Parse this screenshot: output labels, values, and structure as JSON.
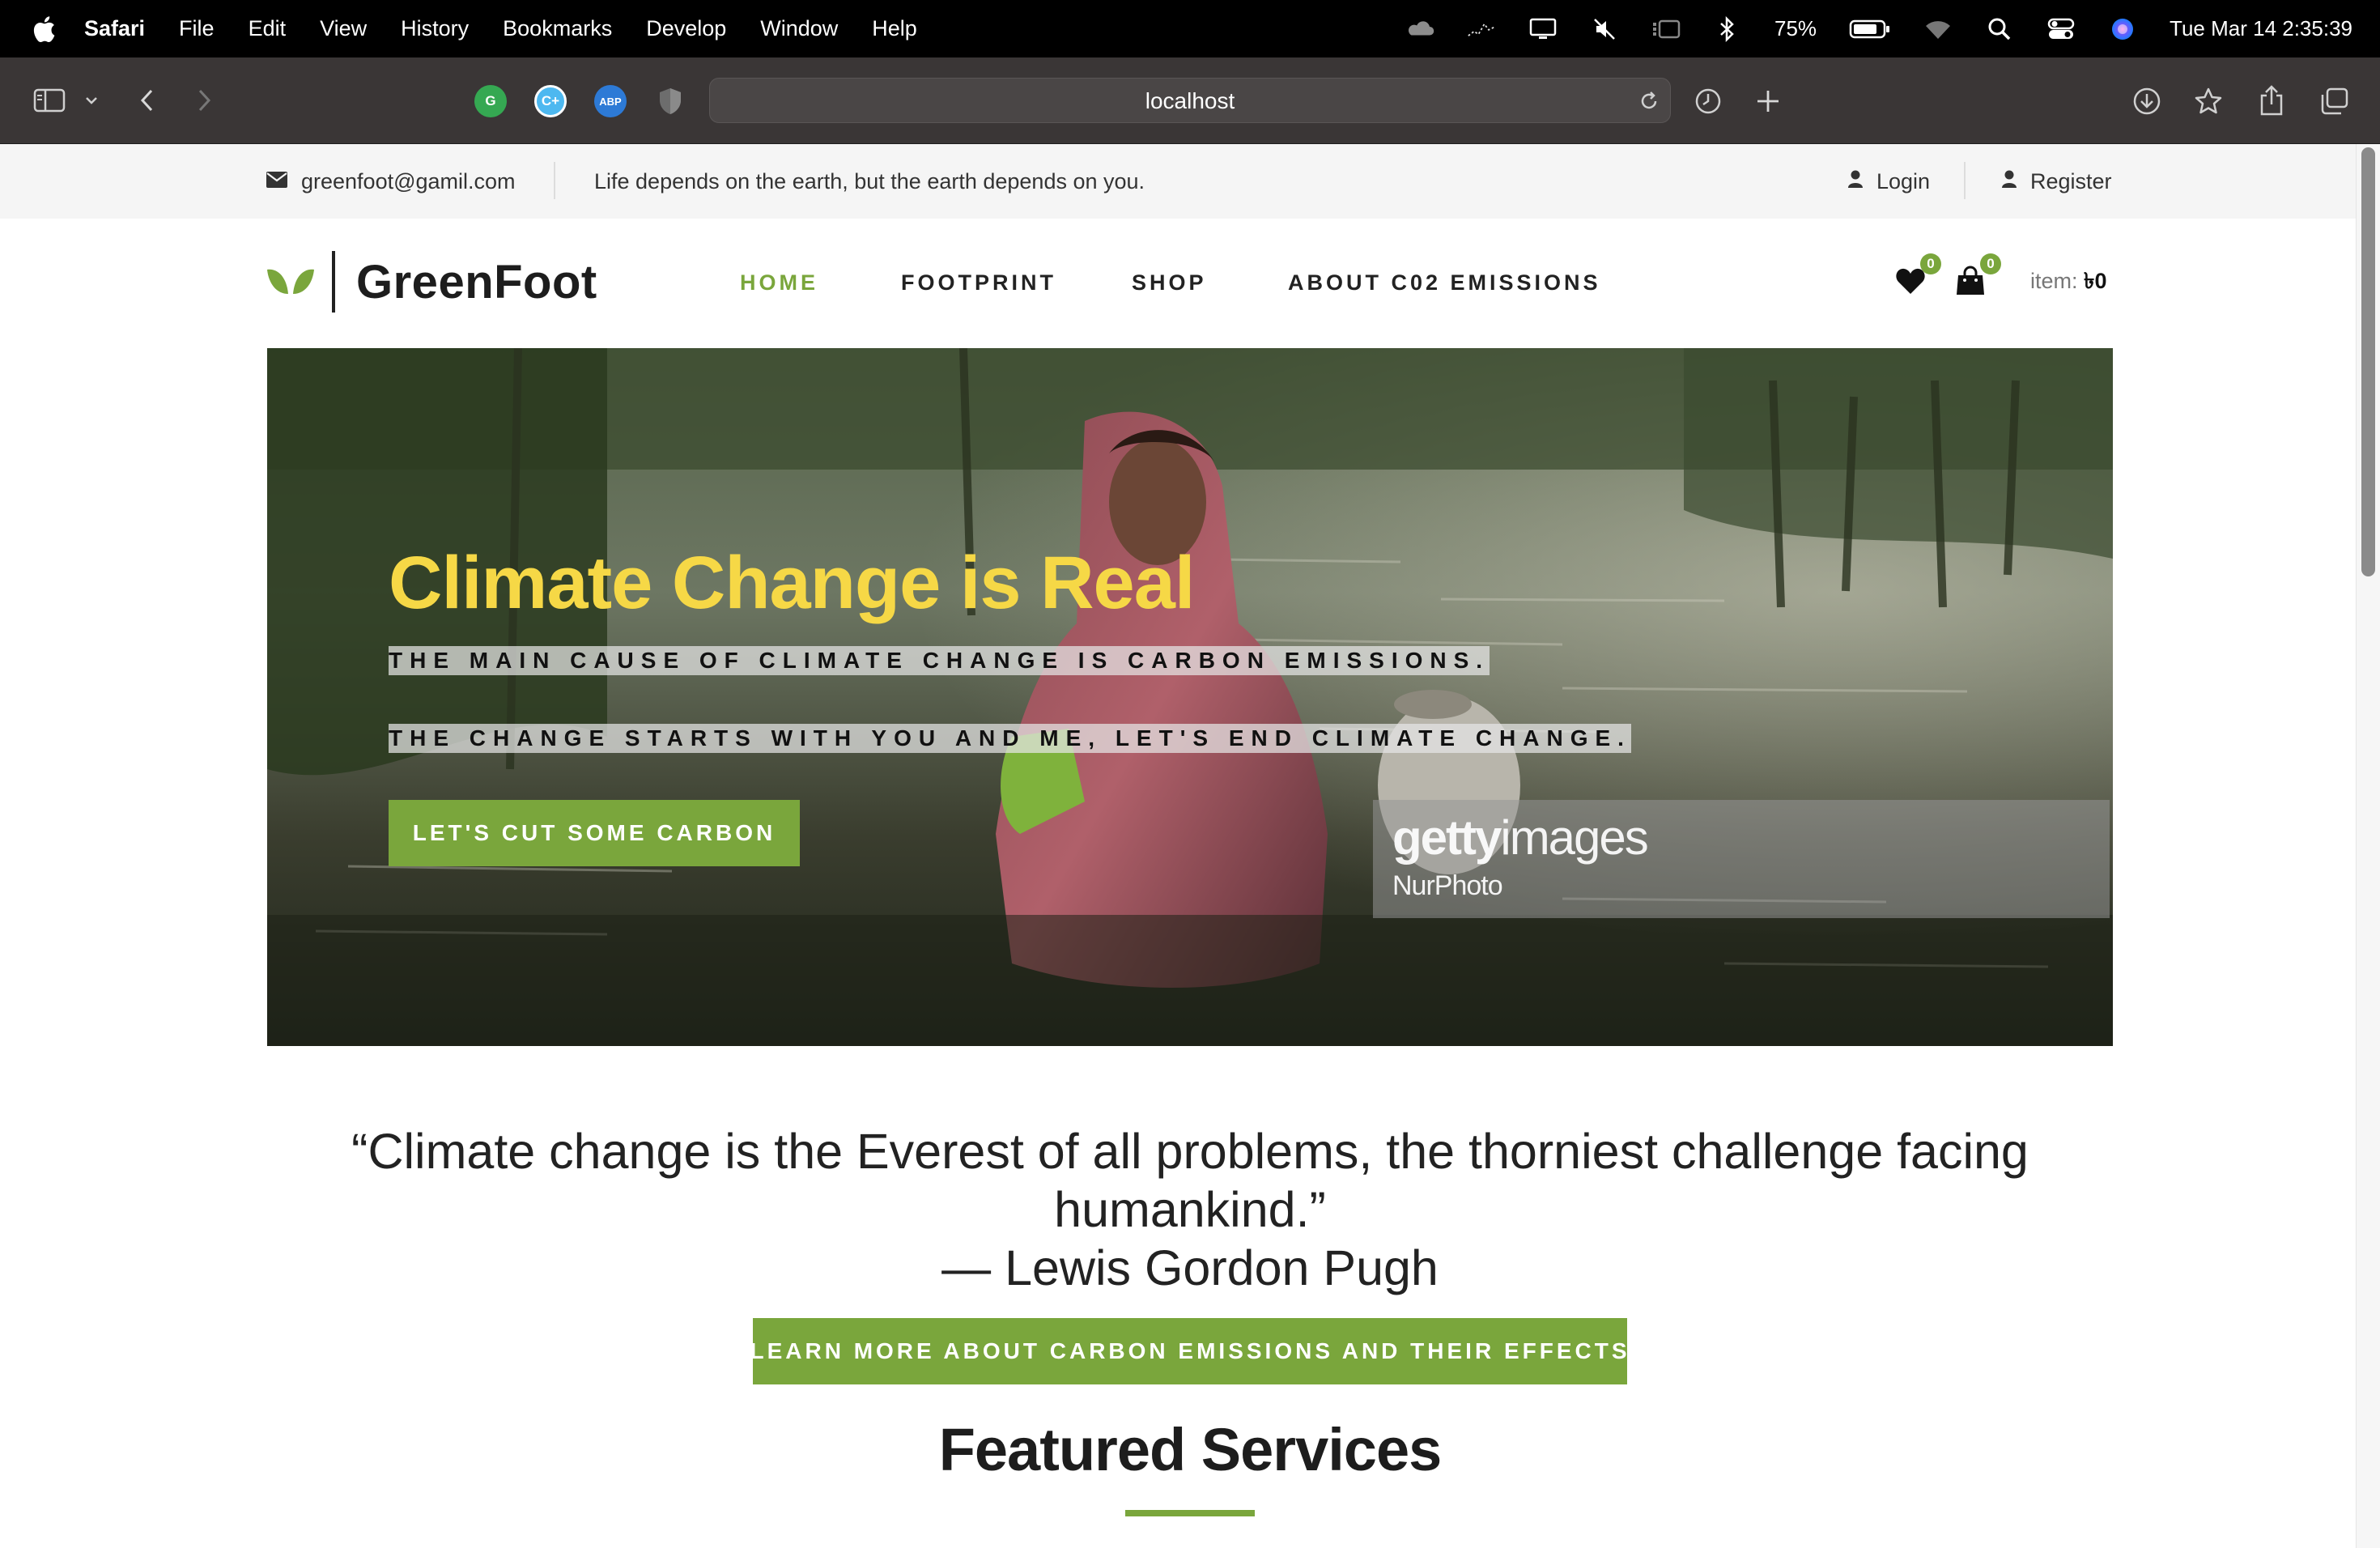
{
  "menubar": {
    "app_name": "Safari",
    "items": [
      "File",
      "Edit",
      "View",
      "History",
      "Bookmarks",
      "Develop",
      "Window",
      "Help"
    ],
    "battery": "75%",
    "datetime": "Tue Mar 14  2:35:39",
    "status_icons": [
      "cloud-icon",
      "wave-icon",
      "display-icon",
      "mute-icon",
      "stage-manager-icon",
      "bluetooth-icon",
      "battery-icon",
      "wifi-icon",
      "spotlight-icon",
      "control-center-icon",
      "siri-icon"
    ]
  },
  "browser": {
    "url": "localhost",
    "extensions": [
      "G",
      "C+",
      "ABP"
    ]
  },
  "topbar": {
    "email": "greenfoot@gamil.com",
    "tagline": "Life depends on the earth, but the earth depends on you.",
    "login": "Login",
    "register": "Register"
  },
  "header": {
    "brand": "GreenFoot",
    "nav": [
      "HOME",
      "FOOTPRINT",
      "SHOP",
      "ABOUT C02 EMISSIONS"
    ],
    "active_nav": "HOME",
    "wishlist_count": "0",
    "cart_count": "0",
    "cart_label": "item:",
    "cart_total": "৳0"
  },
  "hero": {
    "title": "Climate Change is Real",
    "line1": "THE MAIN CAUSE OF CLIMATE CHANGE IS CARBON EMISSIONS.",
    "line2": "THE CHANGE STARTS WITH YOU AND ME, LET'S END CLIMATE CHANGE.",
    "cta": "LET'S CUT SOME CARBON",
    "watermark_brand_bold": "getty",
    "watermark_brand_light": "images",
    "watermark_credit": "NurPhoto"
  },
  "quote": {
    "text": "“Climate change is the Everest of all problems, the thorniest challenge facing humankind.”",
    "author": "— Lewis Gordon Pugh"
  },
  "learn_button": "LEARN MORE ABOUT CARBON EMISSIONS AND THEIR EFFECTS",
  "featured_title": "Featured Services",
  "colors": {
    "accent": "#7aa63c",
    "hero_title": "#f6d846",
    "menubar": "#000000",
    "toolbar": "#3a3636"
  }
}
